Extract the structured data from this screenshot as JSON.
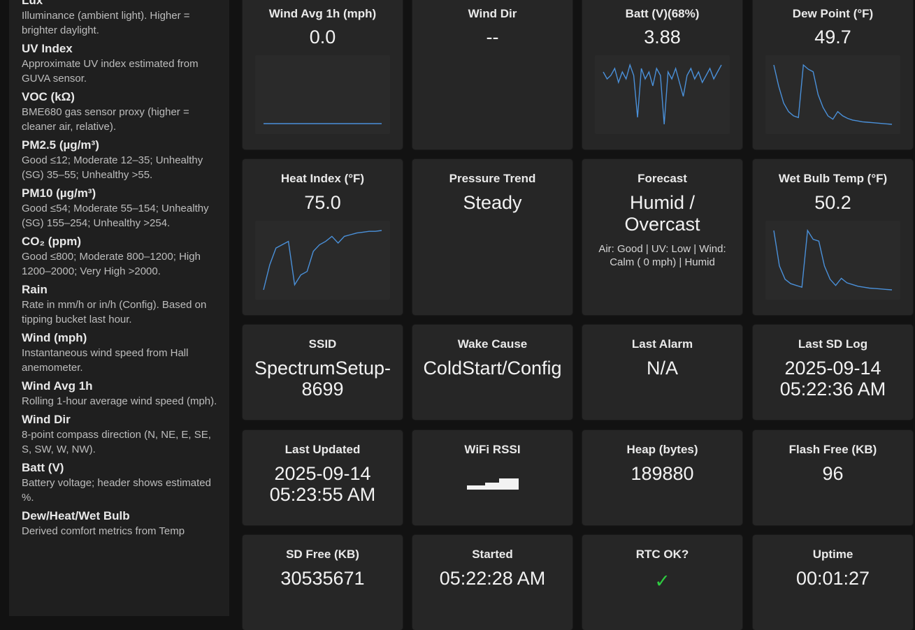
{
  "legend": [
    {
      "title": "Lux",
      "desc": "Illuminance (ambient light). Higher = brighter daylight."
    },
    {
      "title": "UV Index",
      "desc": "Approximate UV index estimated from GUVA sensor."
    },
    {
      "title": "VOC (kΩ)",
      "desc": "BME680 gas sensor proxy (higher = cleaner air, relative)."
    },
    {
      "title": "PM2.5 (µg/m³)",
      "desc": "Good ≤12; Moderate 12–35; Unhealthy (SG) 35–55; Unhealthy >55."
    },
    {
      "title": "PM10 (µg/m³)",
      "desc": "Good ≤54; Moderate 55–154; Unhealthy (SG) 155–254; Unhealthy >254."
    },
    {
      "title": "CO₂ (ppm)",
      "desc": "Good ≤800; Moderate 800–1200; High 1200–2000; Very High >2000."
    },
    {
      "title": "Rain",
      "desc": "Rate in mm/h or in/h (Config). Based on tipping bucket last hour."
    },
    {
      "title": "Wind (mph)",
      "desc": "Instantaneous wind speed from Hall anemometer."
    },
    {
      "title": "Wind Avg 1h",
      "desc": "Rolling 1-hour average wind speed (mph)."
    },
    {
      "title": "Wind Dir",
      "desc": "8-point compass direction (N, NE, E, SE, S, SW, W, NW)."
    },
    {
      "title": "Batt (V)",
      "desc": "Battery voltage; header shows estimated %."
    },
    {
      "title": "Dew/Heat/Wet Bulb",
      "desc": "Derived comfort metrics from Temp"
    }
  ],
  "cards": {
    "wind_avg": {
      "title": "Wind Avg 1h (mph)",
      "value": "0.0"
    },
    "wind_dir": {
      "title": "Wind Dir",
      "value": "--"
    },
    "batt": {
      "title": "Batt (V)(68%)",
      "value": "3.88"
    },
    "dew_point": {
      "title": "Dew Point (°F)",
      "value": "49.7"
    },
    "heat_index": {
      "title": "Heat Index (°F)",
      "value": "75.0"
    },
    "pressure_trend": {
      "title": "Pressure Trend",
      "value": "Steady"
    },
    "forecast": {
      "title": "Forecast",
      "value_line1": "Humid /",
      "value_line2": "Overcast",
      "sub": "Air: Good | UV: Low | Wind: Calm ( 0 mph) | Humid"
    },
    "wet_bulb": {
      "title": "Wet Bulb Temp (°F)",
      "value": "50.2"
    },
    "ssid": {
      "title": "SSID",
      "value_line1": "SpectrumSetup-",
      "value_line2": "8699"
    },
    "wake_cause": {
      "title": "Wake Cause",
      "value": "ColdStart/Config"
    },
    "last_alarm": {
      "title": "Last Alarm",
      "value": "N/A"
    },
    "last_sd_log": {
      "title": "Last SD Log",
      "value_line1": "2025-09-14",
      "value_line2": "05:22:36 AM"
    },
    "last_updated": {
      "title": "Last Updated",
      "value_line1": "2025-09-14",
      "value_line2": "05:23:55 AM"
    },
    "wifi_rssi": {
      "title": "WiFi RSSI",
      "icon": "wifi-signal-bars-icon"
    },
    "heap": {
      "title": "Heap (bytes)",
      "value": "189880"
    },
    "flash_free": {
      "title": "Flash Free (KB)",
      "value": "96"
    },
    "sd_free": {
      "title": "SD Free (KB)",
      "value": "30535671"
    },
    "started": {
      "title": "Started",
      "value": "05:22:28 AM"
    },
    "rtc_ok": {
      "title": "RTC OK?",
      "value": "✓",
      "color": "#2ecc40"
    },
    "uptime": {
      "title": "Uptime",
      "value": "00:01:27"
    }
  },
  "sparks": {
    "wind_avg": [
      0,
      0,
      0,
      0,
      0,
      0,
      0,
      0,
      0,
      0,
      0,
      0
    ],
    "batt": [
      3.89,
      3.87,
      3.88,
      3.9,
      3.86,
      3.89,
      3.87,
      3.91,
      3.88,
      3.76,
      3.9,
      3.87,
      3.89,
      3.85,
      3.9,
      3.88,
      3.74,
      3.89,
      3.87,
      3.9,
      3.86,
      3.82,
      3.88,
      3.9,
      3.87,
      3.89,
      3.86,
      3.88,
      3.9,
      3.87,
      3.89,
      3.91
    ],
    "dew_point": [
      57,
      54.5,
      52.5,
      51.5,
      51,
      50.8,
      57,
      56.5,
      56.2,
      53.5,
      52,
      51,
      50.6,
      51.5,
      51,
      50.7,
      50.5,
      50.4,
      50.3,
      50.25,
      50.2,
      50.15,
      50.1,
      50.05,
      50
    ],
    "heat_index": [
      71.5,
      73,
      74,
      74.2,
      74.4,
      71.8,
      72.4,
      72.6,
      73.8,
      74.2,
      74.4,
      74.7,
      74.3,
      74.7,
      74.8,
      74.9,
      74.95,
      75,
      75,
      75.05
    ],
    "wet_bulb": [
      57,
      53,
      51.5,
      51,
      50.8,
      50.6,
      57,
      56,
      55.8,
      53,
      51.5,
      50.8,
      51.6,
      51.1,
      50.9,
      50.7,
      50.6,
      50.5,
      50.45,
      50.4,
      50.35,
      50.3
    ]
  }
}
